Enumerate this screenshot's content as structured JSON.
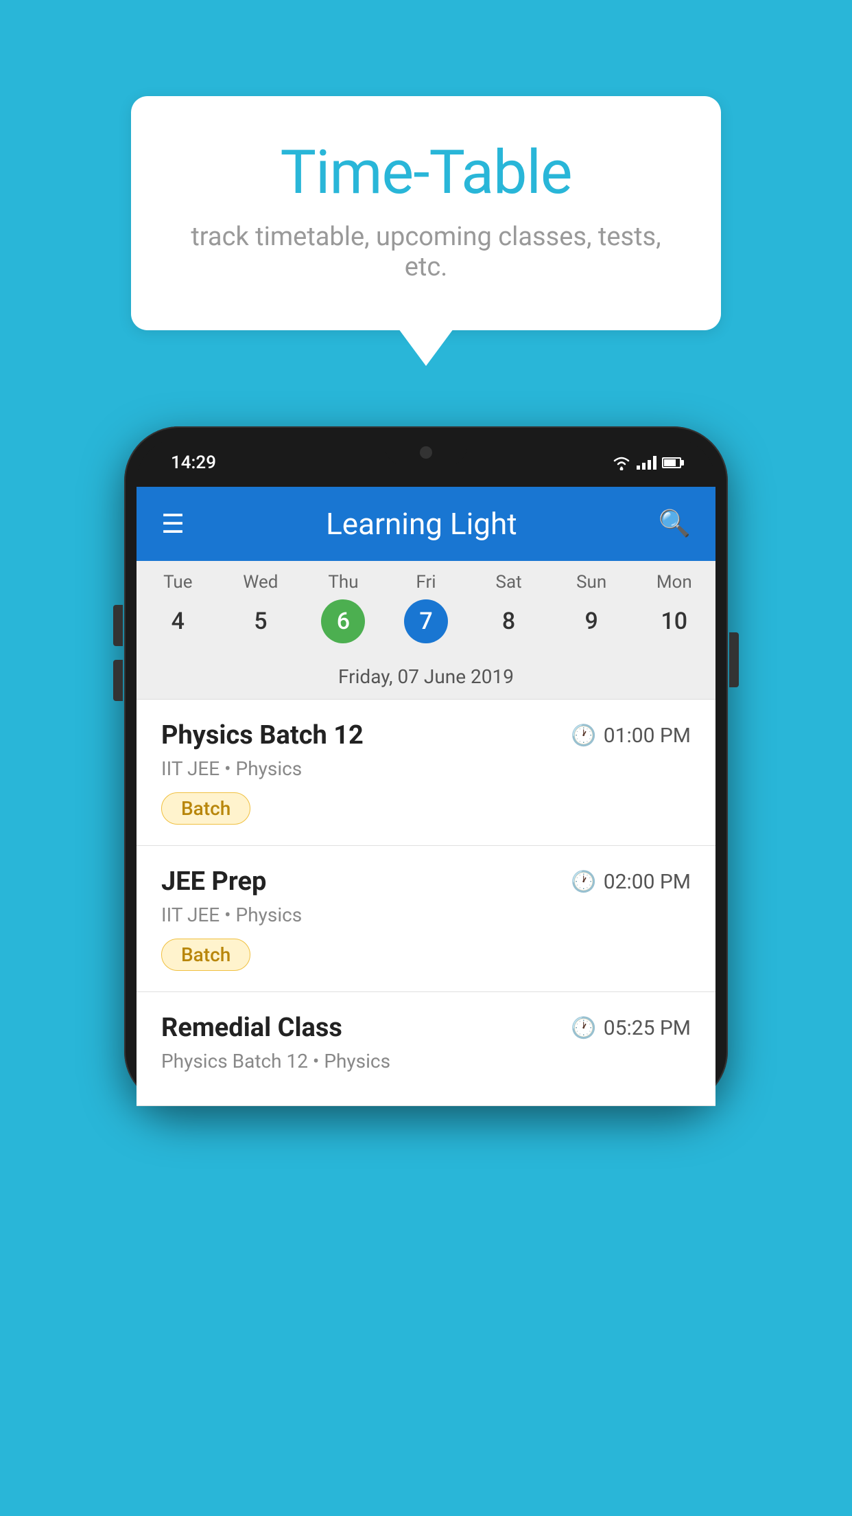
{
  "background_color": "#29B6D8",
  "speech_bubble": {
    "title": "Time-Table",
    "subtitle": "track timetable, upcoming classes, tests, etc."
  },
  "phone": {
    "status_bar": {
      "time": "14:29"
    },
    "app_header": {
      "title": "Learning Light"
    },
    "calendar": {
      "days": [
        {
          "name": "Tue",
          "number": "4",
          "state": "normal"
        },
        {
          "name": "Wed",
          "number": "5",
          "state": "normal"
        },
        {
          "name": "Thu",
          "number": "6",
          "state": "today"
        },
        {
          "name": "Fri",
          "number": "7",
          "state": "selected"
        },
        {
          "name": "Sat",
          "number": "8",
          "state": "normal"
        },
        {
          "name": "Sun",
          "number": "9",
          "state": "normal"
        },
        {
          "name": "Mon",
          "number": "10",
          "state": "normal"
        }
      ],
      "selected_date_label": "Friday, 07 June 2019"
    },
    "classes": [
      {
        "name": "Physics Batch 12",
        "time": "01:00 PM",
        "meta": "IIT JEE • Physics",
        "tag": "Batch"
      },
      {
        "name": "JEE Prep",
        "time": "02:00 PM",
        "meta": "IIT JEE • Physics",
        "tag": "Batch"
      },
      {
        "name": "Remedial Class",
        "time": "05:25 PM",
        "meta": "Physics Batch 12 • Physics",
        "tag": null
      }
    ]
  }
}
